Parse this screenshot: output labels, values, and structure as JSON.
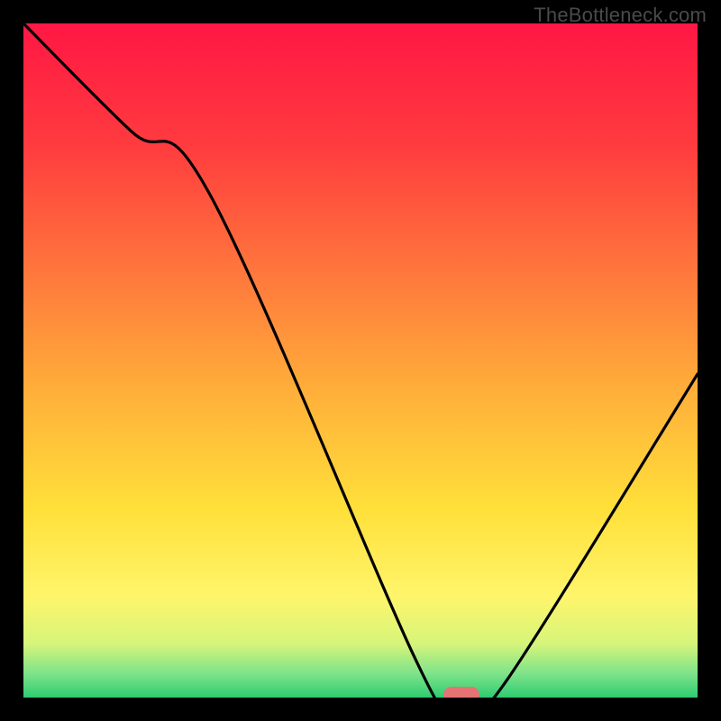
{
  "watermark": {
    "text": "TheBottleneck.com"
  },
  "chart_data": {
    "type": "line",
    "title": "",
    "xlabel": "",
    "ylabel": "",
    "xlim": [
      0,
      100
    ],
    "ylim": [
      0,
      100
    ],
    "grid": false,
    "series": [
      {
        "name": "bottleneck-curve",
        "x": [
          0,
          16,
          28,
          58,
          63,
          67,
          72,
          100
        ],
        "y": [
          100,
          84,
          74,
          6,
          0,
          0,
          3,
          48
        ]
      }
    ],
    "marker": {
      "x": 65,
      "y": 0,
      "color": "#e57373"
    },
    "gradient_stops": [
      {
        "pos": 0.0,
        "color": "#ff1744"
      },
      {
        "pos": 0.18,
        "color": "#ff3b3f"
      },
      {
        "pos": 0.38,
        "color": "#ff7a3c"
      },
      {
        "pos": 0.55,
        "color": "#ffb03a"
      },
      {
        "pos": 0.72,
        "color": "#ffe03a"
      },
      {
        "pos": 0.85,
        "color": "#fff56b"
      },
      {
        "pos": 0.92,
        "color": "#d6f57a"
      },
      {
        "pos": 0.965,
        "color": "#7de38a"
      },
      {
        "pos": 1.0,
        "color": "#2ecc71"
      }
    ]
  }
}
